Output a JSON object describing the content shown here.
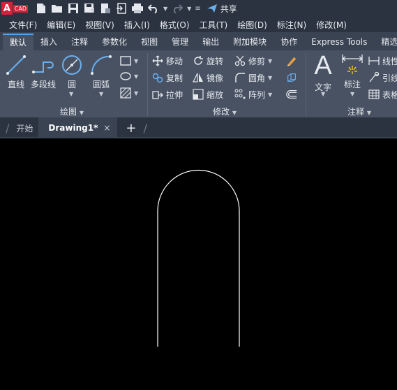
{
  "app": {
    "logo_letter": "A",
    "logo_text": "CAD",
    "share_label": "共享"
  },
  "menu": [
    "文件(F)",
    "编辑(E)",
    "视图(V)",
    "插入(I)",
    "格式(O)",
    "工具(T)",
    "绘图(D)",
    "标注(N)",
    "修改(M)"
  ],
  "ribbon_tabs": [
    "默认",
    "插入",
    "注释",
    "参数化",
    "视图",
    "管理",
    "输出",
    "附加模块",
    "协作",
    "Express Tools",
    "精选"
  ],
  "draw_group": {
    "title": "绘图",
    "line": "直线",
    "polyline": "多段线",
    "circle": "圆",
    "arc": "圆弧"
  },
  "modify_group": {
    "title": "修改",
    "move": "移动",
    "rotate": "旋转",
    "trim": "修剪",
    "copy": "复制",
    "mirror": "镜像",
    "fillet": "圆角",
    "stretch": "拉伸",
    "scale": "缩放",
    "array": "阵列"
  },
  "annotation_group": {
    "title": "注释",
    "text": "文字",
    "dimension": "标注",
    "linear": "线性",
    "leader": "引线",
    "table": "表格"
  },
  "doc_tabs": {
    "start": "开始",
    "drawing": "Drawing1*",
    "close": "×",
    "add": "+"
  },
  "colors": {
    "accent": "#5aa0e6",
    "logo": "#d8203a",
    "ribbon": "#485263",
    "titlebar": "#2b3340",
    "canvas": "#000000",
    "line": "#ffffff"
  }
}
